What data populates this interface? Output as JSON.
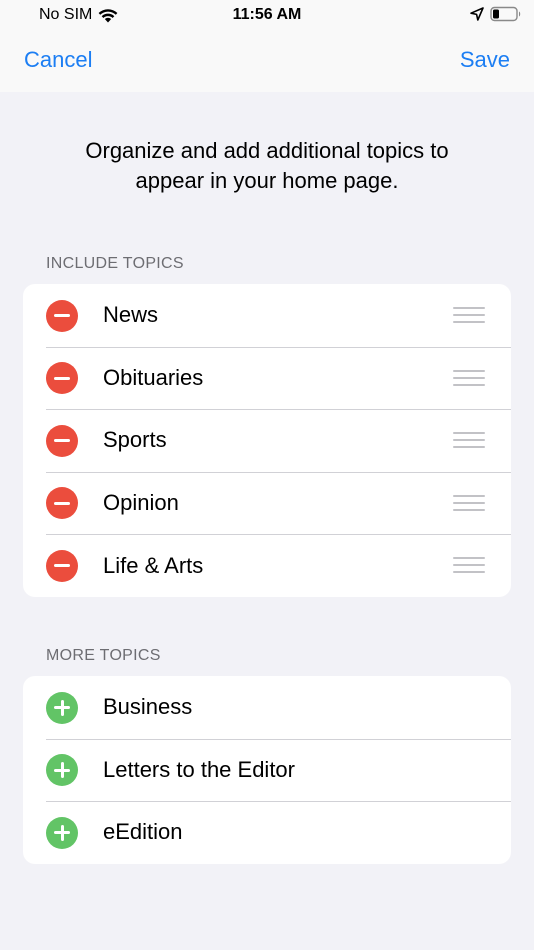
{
  "status": {
    "carrier": "No SIM",
    "time": "11:56 AM",
    "wifi_icon": "wifi-icon",
    "location_icon": "location-arrow-icon",
    "battery_icon": "battery-icon"
  },
  "nav": {
    "cancel_label": "Cancel",
    "save_label": "Save"
  },
  "intro": {
    "line1": "Organize and add additional topics to",
    "line2": "appear in your home page."
  },
  "include": {
    "header": "INCLUDE TOPICS",
    "items": [
      {
        "label": "News"
      },
      {
        "label": "Obituaries"
      },
      {
        "label": "Sports"
      },
      {
        "label": "Opinion"
      },
      {
        "label": "Life & Arts"
      }
    ]
  },
  "more": {
    "header": "MORE TOPICS",
    "items": [
      {
        "label": "Business"
      },
      {
        "label": "Letters to the Editor"
      },
      {
        "label": "eEdition"
      }
    ]
  },
  "colors": {
    "accent": "#1c7ef3",
    "remove": "#eb4d3d",
    "add": "#62c466",
    "background": "#f2f2f7"
  }
}
